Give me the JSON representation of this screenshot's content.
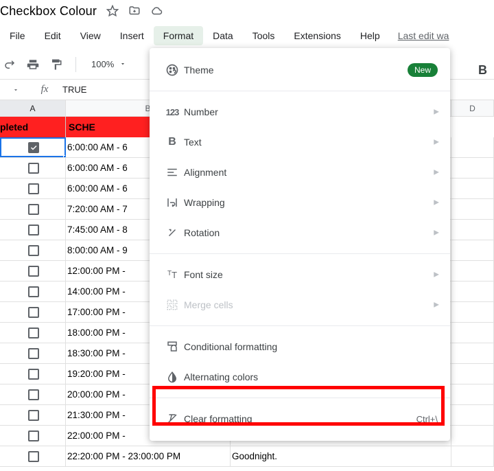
{
  "title": "Checkbox Colour",
  "menus": {
    "file": "File",
    "edit": "Edit",
    "view": "View",
    "insert": "Insert",
    "format": "Format",
    "data": "Data",
    "tools": "Tools",
    "extensions": "Extensions",
    "help": "Help",
    "last_edit": "Last edit wa"
  },
  "toolbar": {
    "zoom": "100%",
    "bold": "B"
  },
  "formula": {
    "fx": "fx",
    "value": "TRUE"
  },
  "columns": {
    "A": "A",
    "B": "B",
    "D": "D"
  },
  "header_row": {
    "A": "pleted",
    "B": "SCHE"
  },
  "rows": [
    {
      "checked": true,
      "b": "6:00:00 AM - 6"
    },
    {
      "checked": false,
      "b": "6:00:00 AM - 6"
    },
    {
      "checked": false,
      "b": "6:00:00 AM - 6"
    },
    {
      "checked": false,
      "b": "7:20:00 AM - 7"
    },
    {
      "checked": false,
      "b": "7:45:00 AM - 8"
    },
    {
      "checked": false,
      "b": "8:00:00 AM - 9"
    },
    {
      "checked": false,
      "b": "12:00:00 PM -"
    },
    {
      "checked": false,
      "b": "14:00:00 PM -"
    },
    {
      "checked": false,
      "b": "17:00:00 PM -"
    },
    {
      "checked": false,
      "b": "18:00:00 PM -"
    },
    {
      "checked": false,
      "b": "18:30:00 PM -"
    },
    {
      "checked": false,
      "b": "19:20:00 PM -"
    },
    {
      "checked": false,
      "b": "20:00:00 PM -"
    },
    {
      "checked": false,
      "b": "21:30:00 PM -"
    },
    {
      "checked": false,
      "b": "22:00:00 PM -"
    },
    {
      "checked": false,
      "b": "22:20:00 PM - 23:00:00 PM",
      "c": "Goodnight."
    }
  ],
  "dropdown": {
    "theme": "Theme",
    "new_badge": "New",
    "number": "Number",
    "text": "Text",
    "alignment": "Alignment",
    "wrapping": "Wrapping",
    "rotation": "Rotation",
    "font_size": "Font size",
    "merge": "Merge cells",
    "conditional": "Conditional formatting",
    "alternating": "Alternating colors",
    "clear": "Clear formatting",
    "clear_shortcut": "Ctrl+\\"
  }
}
